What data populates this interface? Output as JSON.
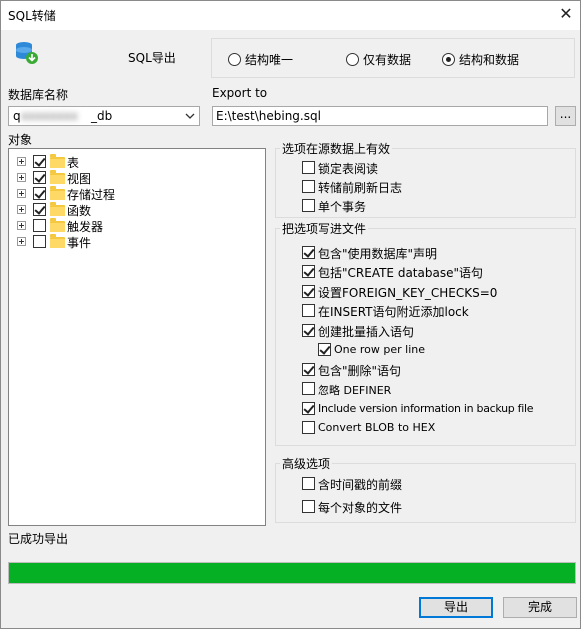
{
  "window": {
    "title": "SQL转储",
    "close_label": "✕"
  },
  "header": {
    "mode_label": "SQL导出",
    "radios": [
      {
        "label": "结构唯一",
        "selected": false
      },
      {
        "label": "仅有数据",
        "selected": false
      },
      {
        "label": "结构和数据",
        "selected": true
      }
    ]
  },
  "database": {
    "label": "数据库名称",
    "value_prefix": "q",
    "value_hidden": "xxxxxxxx",
    "value_suffix": "_db"
  },
  "export": {
    "label": "Export to",
    "path": "E:\\test\\hebing.sql",
    "browse_label": "..."
  },
  "objects": {
    "label": "对象",
    "items": [
      {
        "label": "表",
        "checked": true
      },
      {
        "label": "视图",
        "checked": true
      },
      {
        "label": "存储过程",
        "checked": true
      },
      {
        "label": "函数",
        "checked": true
      },
      {
        "label": "触发器",
        "checked": false
      },
      {
        "label": "事件",
        "checked": false
      }
    ]
  },
  "source_options": {
    "title": "选项在源数据上有效",
    "items": [
      {
        "label": "锁定表阅读",
        "checked": false
      },
      {
        "label": "转储前刷新日志",
        "checked": false
      },
      {
        "label": "单个事务",
        "checked": false
      }
    ]
  },
  "file_options": {
    "title": "把选项写进文件",
    "items": [
      {
        "label": "包含\"使用数据库\"声明",
        "checked": true
      },
      {
        "label": "包括\"CREATE database\"语句",
        "checked": true
      },
      {
        "label": "设置FOREIGN_KEY_CHECKS=0",
        "checked": true
      },
      {
        "label": "在INSERT语句附近添加lock",
        "checked": false
      },
      {
        "label": "创建批量插入语句",
        "checked": true
      },
      {
        "label": "One row per line",
        "checked": true
      },
      {
        "label": "包含\"删除\"语句",
        "checked": true
      },
      {
        "label": "忽略 DEFINER",
        "checked": false
      },
      {
        "label": "Include version information in backup file",
        "checked": true
      },
      {
        "label": "Convert BLOB to HEX",
        "checked": false
      }
    ]
  },
  "advanced_options": {
    "title": "高级选项",
    "items": [
      {
        "label": "含时间戳的前缀",
        "checked": false
      },
      {
        "label": "每个对象的文件",
        "checked": false
      }
    ]
  },
  "status": {
    "message": "已成功导出",
    "progress": 1.0
  },
  "buttons": {
    "export_label": "导出",
    "finish_label": "完成"
  },
  "colors": {
    "progress": "#06b025",
    "accent": "#0078d7"
  }
}
